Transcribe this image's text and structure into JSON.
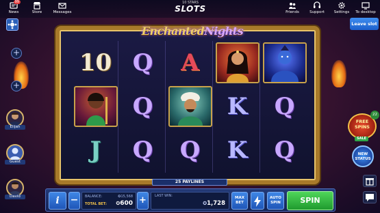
{
  "topbar": {
    "news_label": "News",
    "news_badge": "99",
    "store_label": "Store",
    "messages_label": "Messages",
    "brand_subtitle": "10 STARS",
    "brand_title": "SLOTS",
    "friends_label": "Friends",
    "support_label": "Support",
    "settings_label": "Settings",
    "desktop_label": "To desktop"
  },
  "leave_slot_label": "Leave slot",
  "players": [
    {
      "name": "Elijah"
    },
    {
      "name": "Guest"
    },
    {
      "name": "David"
    }
  ],
  "game": {
    "logo_part1": "Enchanted",
    "logo_part2": "Nights",
    "reels": [
      [
        "10",
        "portrait-woman-green",
        "J"
      ],
      [
        "Q",
        "Q",
        "Q"
      ],
      [
        "A",
        "portrait-man-turban",
        "Q"
      ],
      [
        "portrait-princess",
        "K",
        "K"
      ],
      [
        "portrait-genie",
        "Q",
        "Q"
      ]
    ],
    "paylines_label": "25 PAYLINES"
  },
  "free_spins": {
    "label_line1": "FREE",
    "label_line2": "SPINS",
    "sale_label": "SALE",
    "count": "22"
  },
  "new_status": {
    "line1": "NEW",
    "line2": "STATUS"
  },
  "bottom": {
    "info_glyph": "i",
    "minus_glyph": "−",
    "plus_glyph": "+",
    "balance_label": "BALANCE:",
    "balance_value": "15,568",
    "total_bet_label": "TOTAL BET:",
    "total_bet_value": "600",
    "last_win_label": "LAST WIN:",
    "last_win_value": "1,728",
    "max_bet_line1": "MAX",
    "max_bet_line2": "BET",
    "auto_spin_line1": "AUTO",
    "auto_spin_line2": "SPIN",
    "spin_label": "SPIN"
  },
  "colors": {
    "spin_green": "#3fbf4a",
    "ui_blue": "#2a5fb8",
    "frame_gold": "#a87a2a"
  }
}
